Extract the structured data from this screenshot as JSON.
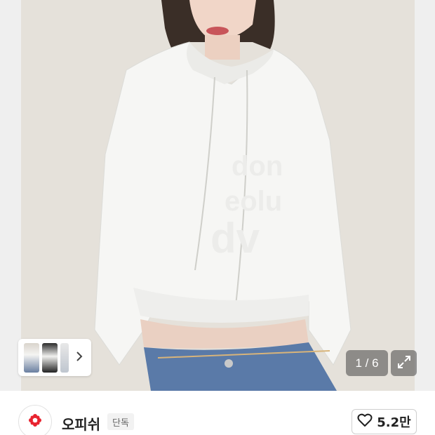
{
  "gallery": {
    "counter": "1 / 6",
    "thumbnails": [
      "thumb-1",
      "thumb-2",
      "thumb-3"
    ],
    "icons": {
      "thumbnail_next": "chevron-right-icon",
      "expand": "expand-icon"
    }
  },
  "brand": {
    "name": "오피쉬",
    "badge": "단독",
    "logo_color": "#e8232f",
    "icons": {
      "logo": "brand-logo-icon"
    }
  },
  "like": {
    "count": "5.2만",
    "icons": {
      "heart": "heart-icon"
    }
  }
}
